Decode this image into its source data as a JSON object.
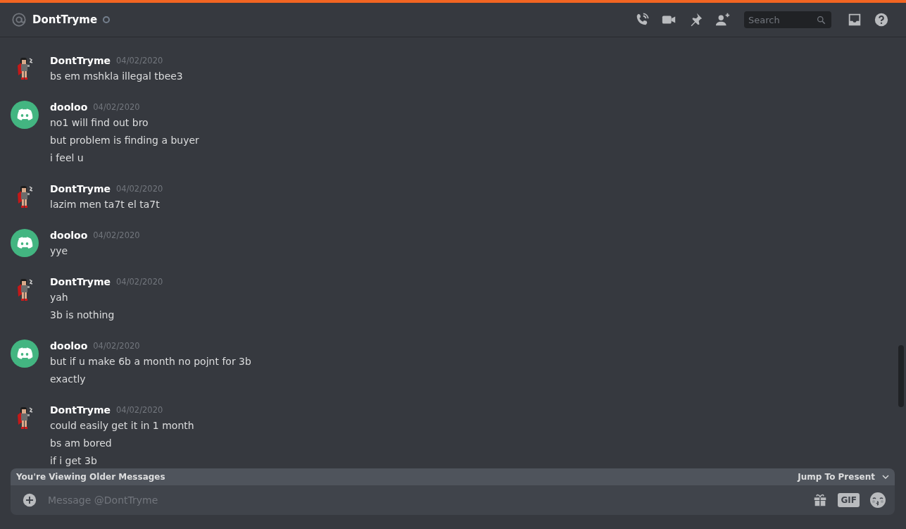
{
  "header": {
    "title": "DontTryme",
    "online": false,
    "search": {
      "placeholder": "Search"
    }
  },
  "messages": [
    {
      "author": "DontTryme",
      "kind": "figure",
      "timestamp": "04/02/2020",
      "lines": [
        "bs em mshkla illegal tbee3"
      ]
    },
    {
      "author": "dooloo",
      "kind": "logo",
      "timestamp": "04/02/2020",
      "lines": [
        "no1 will find out bro",
        "but problem is finding a buyer",
        "i feel u"
      ]
    },
    {
      "author": "DontTryme",
      "kind": "figure",
      "timestamp": "04/02/2020",
      "lines": [
        "lazim men ta7t el ta7t"
      ]
    },
    {
      "author": "dooloo",
      "kind": "logo",
      "timestamp": "04/02/2020",
      "lines": [
        "yye"
      ]
    },
    {
      "author": "DontTryme",
      "kind": "figure",
      "timestamp": "04/02/2020",
      "lines": [
        "yah",
        "3b is nothing"
      ]
    },
    {
      "author": "dooloo",
      "kind": "logo",
      "timestamp": "04/02/2020",
      "lines": [
        "but if u make 6b a month no pojnt for 3b",
        "exactly"
      ]
    },
    {
      "author": "DontTryme",
      "kind": "figure",
      "timestamp": "04/02/2020",
      "lines": [
        "could easily get it in 1 month",
        "bs am bored",
        "if i get 3b"
      ]
    }
  ],
  "banner": {
    "text": "You're Viewing Older Messages",
    "action": "Jump To Present"
  },
  "composer": {
    "placeholder": "Message @DontTryme",
    "gif": "GIF"
  }
}
